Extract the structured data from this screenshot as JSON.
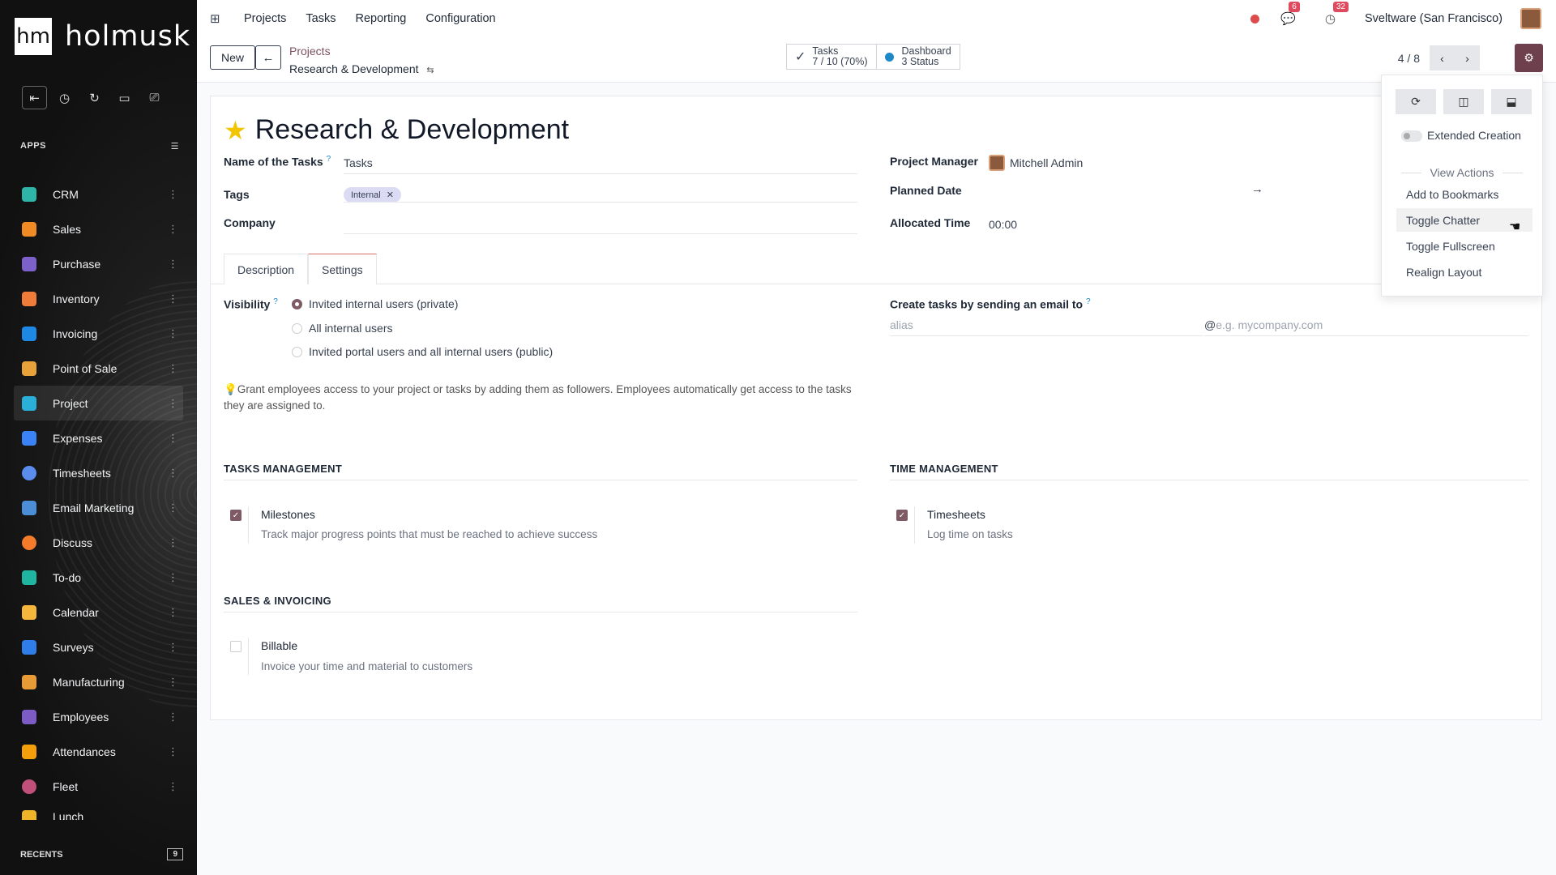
{
  "brand": {
    "logo_mark": "hm",
    "name": "holmusk"
  },
  "sidebar": {
    "apps_label": "APPS",
    "recents_label": "RECENTS",
    "recents_count": "9",
    "apps": [
      {
        "label": "CRM",
        "color": "#2fb5a8"
      },
      {
        "label": "Sales",
        "color": "#f08a24"
      },
      {
        "label": "Purchase",
        "color": "#7b61c9"
      },
      {
        "label": "Inventory",
        "color": "#f07c3a"
      },
      {
        "label": "Invoicing",
        "color": "#1e88e5"
      },
      {
        "label": "Point of Sale",
        "color": "#e8a23a"
      },
      {
        "label": "Project",
        "color": "#2ab0d8"
      },
      {
        "label": "Expenses",
        "color": "#3b82f6"
      },
      {
        "label": "Timesheets",
        "color": "#5b8def"
      },
      {
        "label": "Email Marketing",
        "color": "#4c8dd8"
      },
      {
        "label": "Discuss",
        "color": "#f47b2a"
      },
      {
        "label": "To-do",
        "color": "#1fb5a0"
      },
      {
        "label": "Calendar",
        "color": "#f5b73b"
      },
      {
        "label": "Surveys",
        "color": "#2e7de9"
      },
      {
        "label": "Manufacturing",
        "color": "#e89a34"
      },
      {
        "label": "Employees",
        "color": "#7c5cc4"
      },
      {
        "label": "Attendances",
        "color": "#f59e0b"
      },
      {
        "label": "Fleet",
        "color": "#c0507a"
      },
      {
        "label": "Lunch",
        "color": "#f0b429"
      }
    ]
  },
  "topbar": {
    "menu": [
      "Projects",
      "Tasks",
      "Reporting",
      "Configuration"
    ],
    "messages_count": "6",
    "activities_count": "32",
    "company": "Sveltware (San Francisco)"
  },
  "control": {
    "new_label": "New",
    "breadcrumb_parent": "Projects",
    "breadcrumb_current": "Research & Development",
    "tasks_label": "Tasks",
    "tasks_value": "7 / 10 (70%)",
    "dashboard_label": "Dashboard",
    "dashboard_value": "3 Status",
    "pager": "4 / 8"
  },
  "form": {
    "title": "Research & Development",
    "name_tasks_label": "Name of the Tasks",
    "name_tasks_value": "Tasks",
    "tags_label": "Tags",
    "tag": "Internal",
    "company_label": "Company",
    "project_manager_label": "Project Manager",
    "project_manager_value": "Mitchell Admin",
    "planned_date_label": "Planned Date",
    "allocated_time_label": "Allocated Time",
    "allocated_time_value": "00:00",
    "tabs": [
      "Description",
      "Settings"
    ],
    "visibility_label": "Visibility",
    "visibility_options": [
      "Invited internal users (private)",
      "All internal users",
      "Invited portal users and all internal users (public)"
    ],
    "visibility_hint": "Grant employees access to your project or tasks by adding them as followers. Employees automatically get access to the tasks they are assigned to.",
    "email_label": "Create tasks by sending an email to",
    "alias_placeholder": "alias",
    "domain_placeholder": "e.g. mycompany.com",
    "tasks_management": "TASKS MANAGEMENT",
    "milestones_title": "Milestones",
    "milestones_desc": "Track major progress points that must be reached to achieve success",
    "time_management": "TIME MANAGEMENT",
    "timesheets_title": "Timesheets",
    "timesheets_desc": "Log time on tasks",
    "sales_invoicing": "SALES & INVOICING",
    "billable_title": "Billable",
    "billable_desc": "Invoice your time and material to customers"
  },
  "dropdown": {
    "extended_creation": "Extended Creation",
    "view_actions": "View Actions",
    "items": [
      "Add to Bookmarks",
      "Toggle Chatter",
      "Toggle Fullscreen",
      "Realign Layout"
    ]
  },
  "colors": {
    "accent": "#6e3f4d",
    "link": "#7c4f5c"
  }
}
